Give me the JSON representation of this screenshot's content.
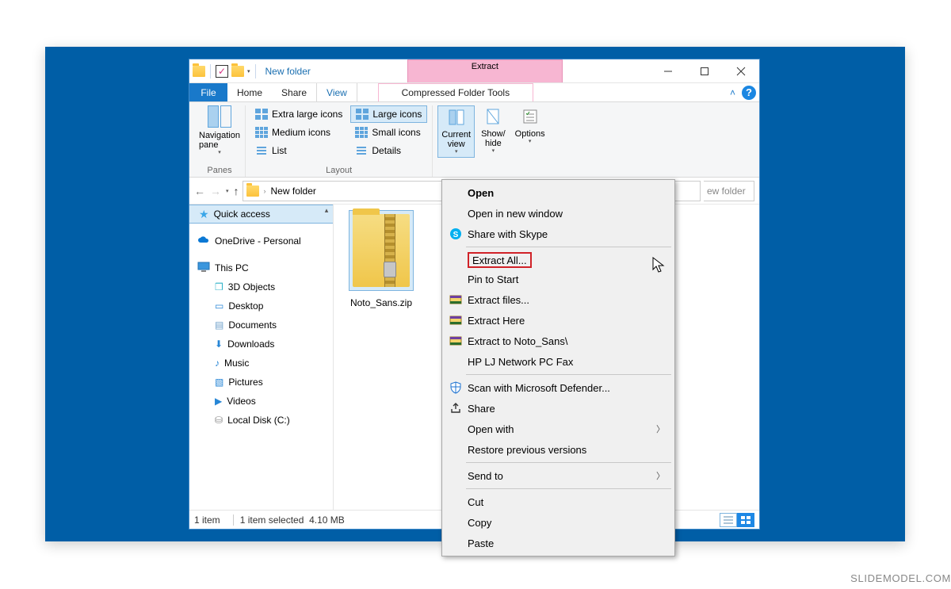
{
  "titlebar": {
    "title": "New folder",
    "context_tab": "Extract"
  },
  "menubar": {
    "file": "File",
    "tabs": [
      "Home",
      "Share",
      "View"
    ],
    "context_tool": "Compressed Folder Tools"
  },
  "ribbon": {
    "panes_group": "Panes",
    "nav_pane": "Navigation\npane",
    "layout_group": "Layout",
    "layout": {
      "xl": "Extra large icons",
      "lg": "Large icons",
      "md": "Medium icons",
      "sm": "Small icons",
      "list": "List",
      "details": "Details"
    },
    "current_view": "Current\nview",
    "show_hide": "Show/\nhide",
    "options": "Options"
  },
  "address": {
    "path": "New folder",
    "search_fragment": "ew folder"
  },
  "sidebar": {
    "quick_access": "Quick access",
    "onedrive": "OneDrive - Personal",
    "this_pc": "This PC",
    "children": [
      "3D Objects",
      "Desktop",
      "Documents",
      "Downloads",
      "Music",
      "Pictures",
      "Videos",
      "Local Disk (C:)"
    ]
  },
  "content": {
    "file_name": "Noto_Sans.zip"
  },
  "statusbar": {
    "items": "1 item",
    "selected": "1 item selected",
    "size": "4.10 MB"
  },
  "context_menu": {
    "open": "Open",
    "open_new": "Open in new window",
    "skype": "Share with Skype",
    "extract_all": "Extract All...",
    "pin": "Pin to Start",
    "extract_files": "Extract files...",
    "extract_here": "Extract Here",
    "extract_to": "Extract to Noto_Sans\\",
    "hp": "HP LJ Network PC Fax",
    "defender": "Scan with Microsoft Defender...",
    "share": "Share",
    "open_with": "Open with",
    "restore": "Restore previous versions",
    "send_to": "Send to",
    "cut": "Cut",
    "copy": "Copy",
    "paste": "Paste"
  },
  "watermark": "SLIDEMODEL.COM"
}
